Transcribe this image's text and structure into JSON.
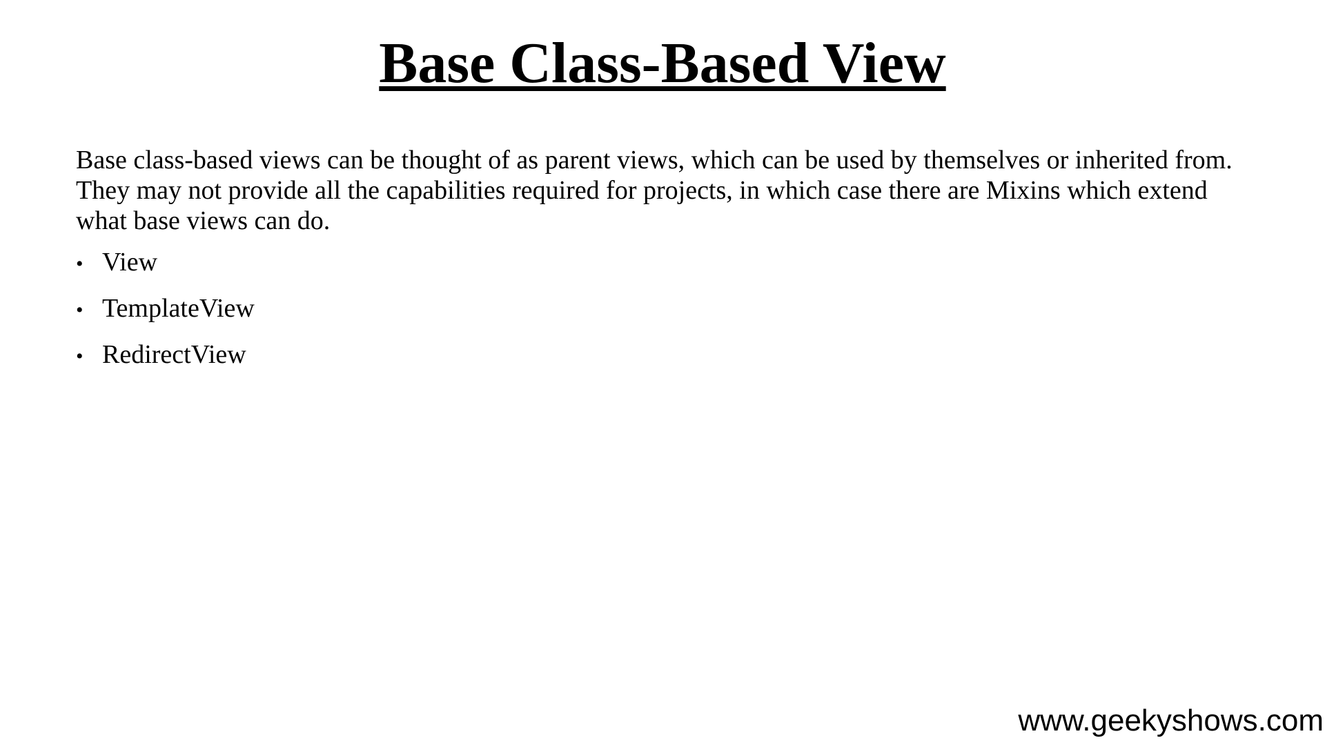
{
  "slide": {
    "title": "Base Class-Based View",
    "paragraph": "Base class-based views can be thought of as parent views, which can be used by themselves or inherited from. They may not provide all the capabilities required for projects, in which case there are Mixins which extend what base views can do.",
    "bullet_symbol": "•",
    "bullets": [
      "View",
      "TemplateView",
      "RedirectView"
    ],
    "footer_url": "www.geekyshows.com"
  }
}
